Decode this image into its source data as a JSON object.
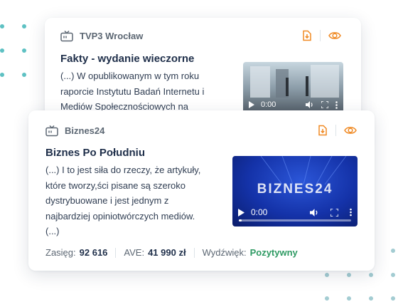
{
  "colors": {
    "accent_orange": "#f08a24",
    "positive_green": "#2e9a63",
    "title_navy": "#1f2f4a",
    "dots": "#a3ccd2"
  },
  "cards": [
    {
      "source_icon": "tv-icon",
      "source": "TVP3 Wrocław",
      "title": "Fakty - wydanie wieczorne",
      "excerpt": " (...) W opublikowanym w tym roku\nraporcie Instytutu Badań Internetu i\nMediów Społecznościowych na",
      "video": {
        "time": "0:00"
      }
    },
    {
      "source_icon": "tv-icon",
      "source": "Biznes24",
      "title": "Biznes Po Południu",
      "excerpt": "(...) I to jest siła do rzeczy,  że artykuły,\nktóre tworzy,ści pisane są szeroko\ndystrybuowane  i jest jednym z\nnajbardziej opiniotwórczych mediów.\n(...)",
      "video": {
        "logo": "BIZNES24",
        "time": "0:00"
      },
      "metrics": [
        {
          "label": "Zasięg:",
          "value": "92 616"
        },
        {
          "label": "AVE:",
          "value": "41 990 zł"
        },
        {
          "label": "Wydźwięk:",
          "value": "Pozytywny"
        }
      ]
    }
  ]
}
